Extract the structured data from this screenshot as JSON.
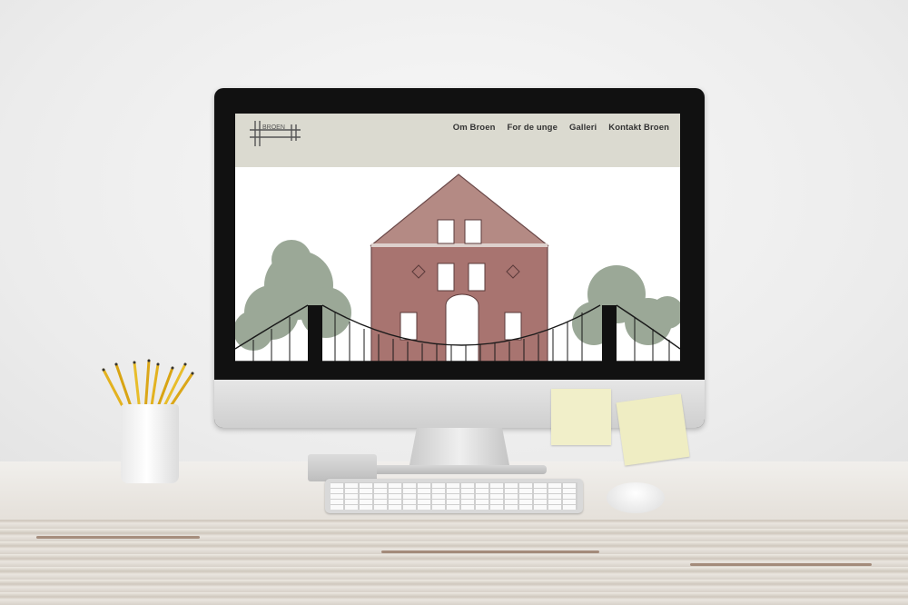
{
  "site": {
    "nav": [
      {
        "label": "Om Broen"
      },
      {
        "label": "For de unge"
      },
      {
        "label": "Galleri"
      },
      {
        "label": "Kontakt Broen"
      }
    ],
    "logo_text": "BROEN"
  },
  "colors": {
    "header_bg": "#dbdad0",
    "nav_text": "#333333",
    "brick": "#a86a6a",
    "note": "#f1efc9"
  },
  "icons": [
    "bridge-logo-icon"
  ]
}
